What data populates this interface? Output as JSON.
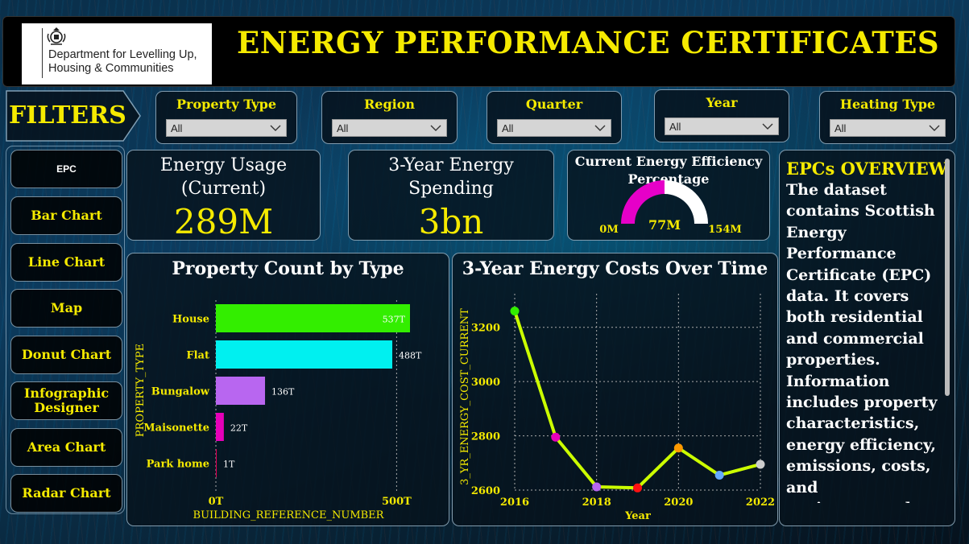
{
  "header": {
    "org_line1": "Department for Levelling Up,",
    "org_line2": "Housing & Communities",
    "title": "ENERGY PERFORMANCE CERTIFICATES"
  },
  "filters": {
    "label": "FILTERS",
    "items": [
      {
        "title": "Property Type",
        "value": "All"
      },
      {
        "title": "Region",
        "value": "All"
      },
      {
        "title": "Quarter",
        "value": "All"
      },
      {
        "title": "Year",
        "value": "All"
      },
      {
        "title": "Heating Type",
        "value": "All"
      }
    ]
  },
  "nav": {
    "items": [
      {
        "label": "EPC",
        "active": true
      },
      {
        "label": "Bar Chart"
      },
      {
        "label": "Line Chart"
      },
      {
        "label": "Map"
      },
      {
        "label": "Donut Chart"
      },
      {
        "label": "Infographic Designer"
      },
      {
        "label": "Area Chart"
      },
      {
        "label": "Radar Chart"
      }
    ]
  },
  "cards": {
    "energy_usage": {
      "title_line1": "Energy Usage",
      "title_line2": "(Current)",
      "value": "289M"
    },
    "energy_spending": {
      "title_line1": "3-Year Energy",
      "title_line2": "Spending",
      "value": "3bn"
    },
    "efficiency": {
      "title_line1": "Current Energy Efficiency",
      "title_line2": "Percentage",
      "min_label": "0M",
      "value_label": "77M",
      "max_label": "154M",
      "value": 77,
      "min": 0,
      "max": 154
    }
  },
  "overview": {
    "title": "EPCs OVERVIEW",
    "body": "The dataset contains Scottish Energy Performance Certificate (EPC) data. It covers both residential and commercial properties. Information includes property characteristics, energy efficiency, emissions, costs, and environmental impact. The data"
  },
  "colors": {
    "accent": "#f5ea00",
    "gauge_fill": "#e600c8",
    "gauge_rest": "#ffffff"
  },
  "chart_data": [
    {
      "type": "bar",
      "orientation": "horizontal",
      "title": "Property Count by Type",
      "xlabel": "BUILDING_REFERENCE_NUMBER",
      "ylabel": "PROPERTY_TYPE",
      "categories": [
        "House",
        "Flat",
        "Bungalow",
        "Maisonette",
        "Park home"
      ],
      "values": [
        537000,
        488000,
        136000,
        22000,
        1000
      ],
      "data_labels": [
        "537T",
        "488T",
        "136T",
        "22T",
        "1T"
      ],
      "bar_colors": [
        "#33ee00",
        "#00f0f0",
        "#b866f0",
        "#e600b8",
        "#e6005a"
      ],
      "xlim": [
        0,
        537000
      ],
      "x_ticks": [
        0,
        500000
      ],
      "x_tick_labels": [
        "0T",
        "500T"
      ]
    },
    {
      "type": "line",
      "title": "3-Year Energy Costs Over Time",
      "xlabel": "Year",
      "ylabel": "3_YR_ENERGY_COST_CURRENT",
      "x": [
        2016,
        2017,
        2018,
        2019,
        2020,
        2021,
        2022
      ],
      "y": [
        3260,
        2795,
        2612,
        2608,
        2755,
        2655,
        2695
      ],
      "point_colors": [
        "#33ee00",
        "#e600b8",
        "#b866f0",
        "#ff1111",
        "#ff9900",
        "#66aaff",
        "#cccccc"
      ],
      "line_color": "#ccff00",
      "xlim": [
        2016,
        2022
      ],
      "ylim": [
        2600,
        3300
      ],
      "x_ticks": [
        2016,
        2018,
        2020,
        2022
      ],
      "y_ticks": [
        2600,
        2800,
        3000,
        3200
      ],
      "grid": true
    }
  ]
}
